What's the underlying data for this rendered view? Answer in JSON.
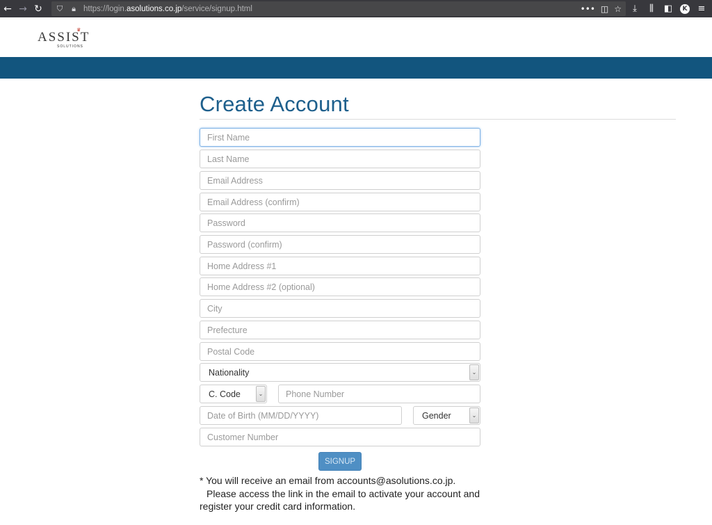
{
  "browser": {
    "url_prefix": "https://login.",
    "url_domain": "asolutions.co.jp",
    "url_path": "/service/signup.html",
    "icons": {
      "back": "back-arrow-icon",
      "forward": "forward-arrow-icon",
      "reload": "reload-icon",
      "shield": "tracking-shield-icon",
      "lock": "lock-icon",
      "more": "more-actions-icon",
      "pocket": "pocket-icon",
      "bookmark": "bookmark-star-icon",
      "download": "download-icon",
      "library": "library-icon",
      "sidebar": "sidebar-icon",
      "account": "account-icon",
      "menu": "hamburger-menu-icon"
    },
    "account_initial": "K"
  },
  "site": {
    "logo_text": "ASSIST",
    "logo_subtext": "SOLUTIONS",
    "brand_color": "#12557e"
  },
  "form": {
    "title": "Create Account",
    "fields": {
      "first_name": "First Name",
      "last_name": "Last Name",
      "email": "Email Address",
      "email_confirm": "Email Address (confirm)",
      "password": "Password",
      "password_confirm": "Password (confirm)",
      "address1": "Home Address #1",
      "address2": "Home Address #2 (optional)",
      "city": "City",
      "prefecture": "Prefecture",
      "postal": "Postal Code",
      "phone": "Phone Number",
      "dob": "Date of Birth (MM/DD/YYYY)",
      "customer_number": "Customer Number"
    },
    "selects": {
      "nationality": "Nationality",
      "country_code": "C. Code",
      "gender": "Gender"
    },
    "submit_label": "SIGNUP",
    "note_line1": "* You will receive an email from accounts@asolutions.co.jp.",
    "note_line2": "Please access the link in the email to activate your account and",
    "note_line3": "register your credit card information."
  }
}
